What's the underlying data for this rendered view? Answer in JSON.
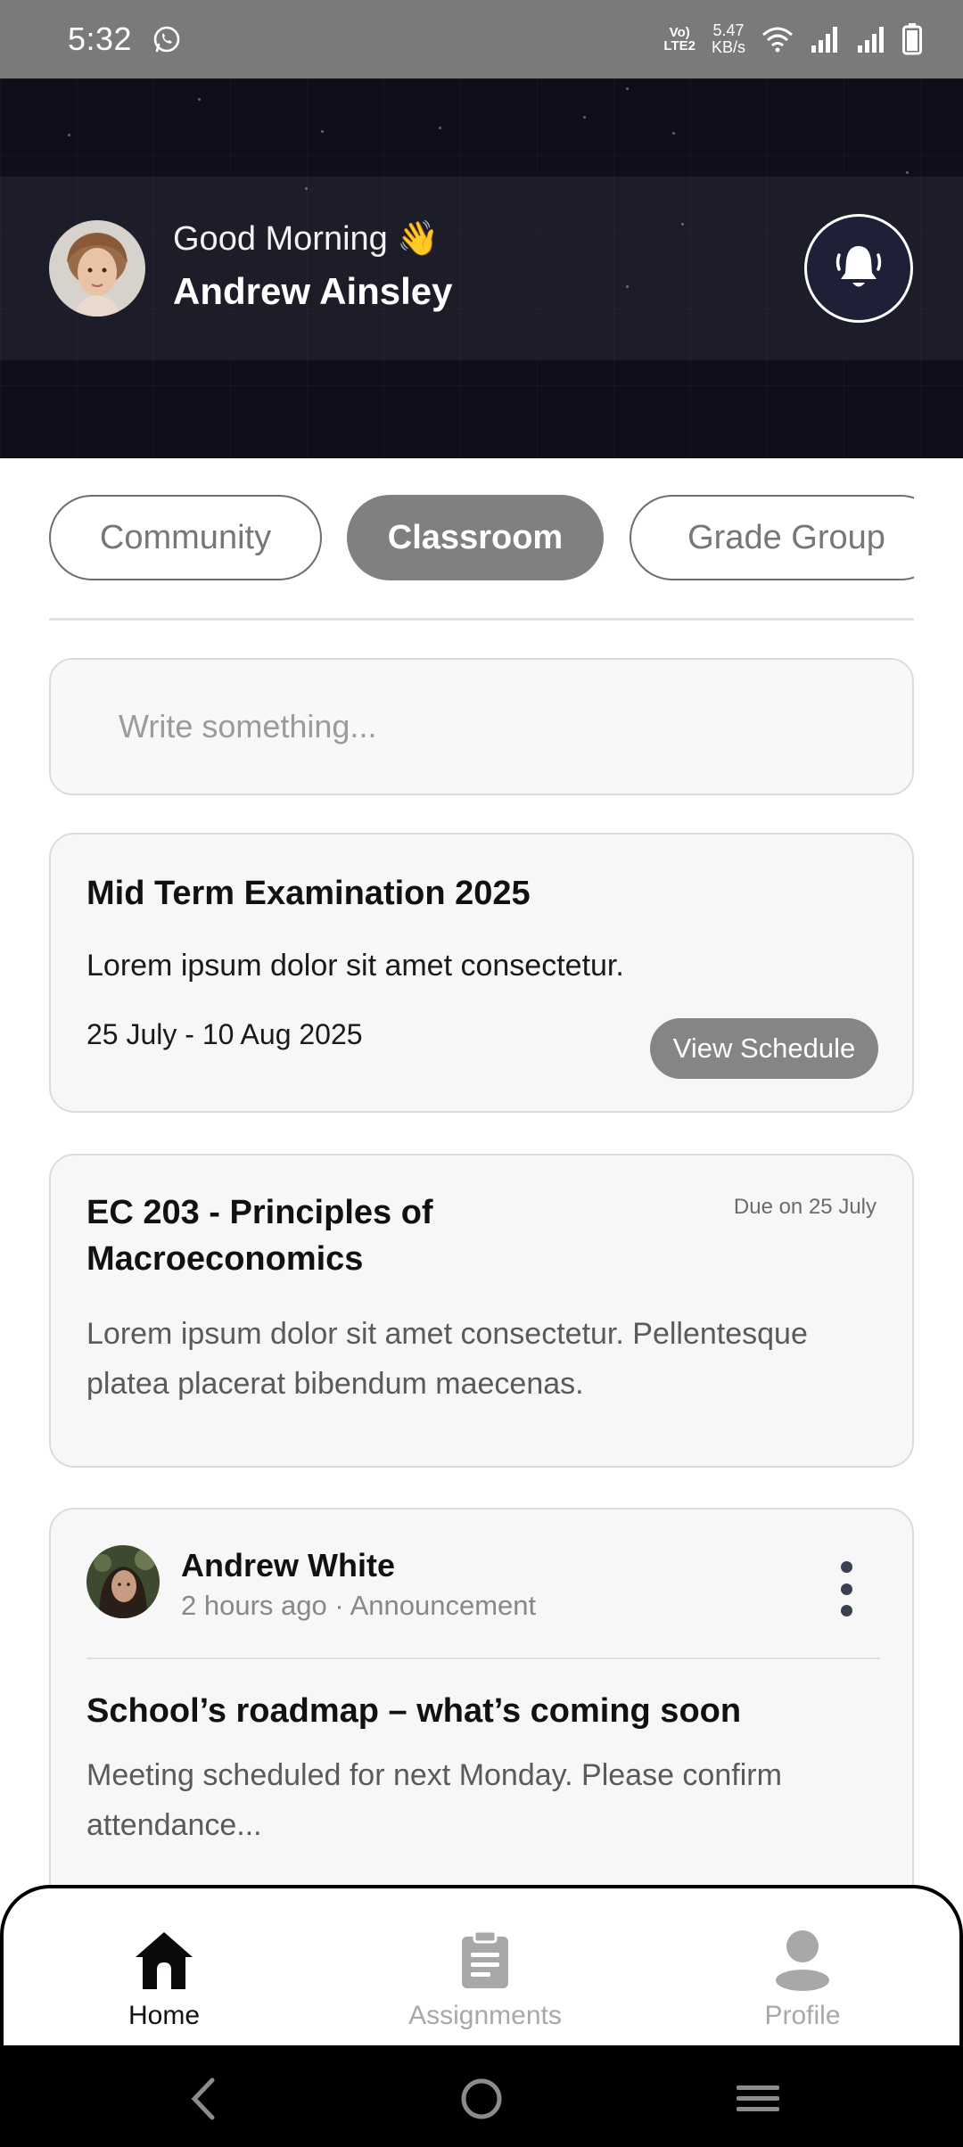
{
  "status_bar": {
    "time": "5:32",
    "volte_line1": "Vo)",
    "volte_line2": "LTE2",
    "speed_value": "5.47",
    "speed_unit": "KB/s",
    "icons": [
      "whatsapp-icon",
      "wifi-icon",
      "signal-icon",
      "signal-icon",
      "battery-icon"
    ]
  },
  "header": {
    "greeting": "Good Morning 👋",
    "user_name": "Andrew Ainsley"
  },
  "tabs": [
    {
      "label": "Community",
      "active": false
    },
    {
      "label": "Classroom",
      "active": true
    },
    {
      "label": "Grade Group",
      "active": false
    }
  ],
  "composer": {
    "placeholder": "Write something..."
  },
  "exam_card": {
    "title": "Mid Term Examination 2025",
    "body": "Lorem ipsum dolor sit amet consectetur.",
    "date_range": "25 July - 10 Aug 2025",
    "button_label": "View Schedule"
  },
  "assignment_card": {
    "title_line1": "EC 203 - Principles of",
    "title_line2": "Macroeconomics",
    "due": "Due on 25 July",
    "body_line1": "Lorem ipsum dolor sit amet consectetur. Pellentesque",
    "body_line2": "platea placerat bibendum maecenas."
  },
  "post_card": {
    "author": "Andrew White",
    "meta": "2 hours ago · Announcement",
    "title": "School’s roadmap – what’s coming soon",
    "body_line1": "Meeting scheduled for next Monday. Please confirm",
    "body_line2": "attendance..."
  },
  "bottom_nav": {
    "items": [
      {
        "label": "Home",
        "icon": "home-icon",
        "active": true
      },
      {
        "label": "Assignments",
        "icon": "clipboard-icon",
        "active": false
      },
      {
        "label": "Profile",
        "icon": "person-icon",
        "active": false
      }
    ]
  },
  "colors": {
    "header_bg": "#0f0f1c",
    "active_tab": "#808080",
    "card_bg": "#f7f7f7",
    "status_bar": "#7a7a7a"
  }
}
